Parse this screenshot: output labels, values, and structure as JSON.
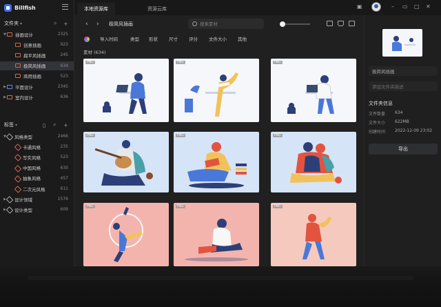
{
  "app": {
    "name": "Billfish"
  },
  "tabs": [
    "本地资源库",
    "资源云库"
  ],
  "sidebar": {
    "folders_title": "文件夹",
    "folders": [
      {
        "label": "插画设计",
        "count": "2325",
        "level": 0,
        "open": true,
        "color": "red"
      },
      {
        "label": "创意插画",
        "count": "923",
        "level": 1,
        "color": "red"
      },
      {
        "label": "扁平风插画",
        "count": "245",
        "level": 1,
        "color": "red"
      },
      {
        "label": "极简风插画",
        "count": "634",
        "level": 1,
        "color": "red",
        "active": true
      },
      {
        "label": "商用插画",
        "count": "523",
        "level": 1,
        "color": "red"
      },
      {
        "label": "平面设计",
        "count": "2345",
        "level": 0,
        "color": "blue"
      },
      {
        "label": "室内设计",
        "count": "636",
        "level": 0,
        "color": "red"
      }
    ],
    "tags_title": "标签",
    "tags": [
      {
        "label": "风格类型",
        "count": "2466",
        "level": 0,
        "open": true
      },
      {
        "label": "卡通风格",
        "count": "235",
        "level": 1
      },
      {
        "label": "写实风格",
        "count": "523",
        "level": 1
      },
      {
        "label": "中国风格",
        "count": "630",
        "level": 1
      },
      {
        "label": "抽象风格",
        "count": "457",
        "level": 1
      },
      {
        "label": "二次元风格",
        "count": "611",
        "level": 1
      },
      {
        "label": "设计领域",
        "count": "1576",
        "level": 0
      },
      {
        "label": "设计类型",
        "count": "609",
        "level": 0
      }
    ]
  },
  "toolbar": {
    "breadcrumb": "极简风插画",
    "search_placeholder": "搜索素材"
  },
  "filters": [
    "导入时间",
    "类型",
    "形状",
    "尺寸",
    "评分",
    "文件大小",
    "其他"
  ],
  "count_label": "素材 (634)",
  "grid": {
    "badge": "PNG",
    "cards": [
      {
        "bg": "#f6f7fb"
      },
      {
        "bg": "#f6f7fb"
      },
      {
        "bg": "#f6f7fb"
      },
      {
        "bg": "#d6e4f8"
      },
      {
        "bg": "#d6e4f8"
      },
      {
        "bg": "#d6e4f8"
      },
      {
        "bg": "#f4b4ae"
      },
      {
        "bg": "#f4b4ae"
      },
      {
        "bg": "#f6c9bf"
      }
    ]
  },
  "panel": {
    "name_value": "极简风插画",
    "desc_placeholder": "添加文件夹描述",
    "info_title": "文件夹信息",
    "rows": [
      {
        "k": "文件数量",
        "v": "634"
      },
      {
        "k": "文件大小",
        "v": "622MB"
      },
      {
        "k": "创建时间",
        "v": "2022-12-09 23:02"
      }
    ],
    "export_label": "导出"
  },
  "colors": {
    "accent": "#3d6df2",
    "folder": "#d26a4d",
    "folder_blue": "#5b8de8"
  }
}
